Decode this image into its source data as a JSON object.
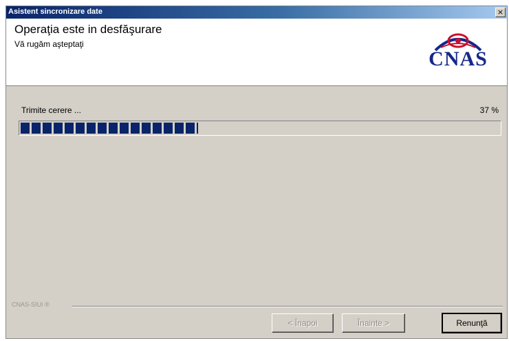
{
  "window": {
    "title": "Asistent sincronizare date",
    "close_glyph": "×"
  },
  "header": {
    "heading": "Operaţia este in desfăşurare",
    "subheading": "Vă rugăm aşteptaţi",
    "logo_text": "CNAS",
    "logo_colors": {
      "eye": "#c8102e",
      "arc": "#16288a"
    }
  },
  "status": {
    "label": "Trimite cerere ...",
    "percent_text": "37 %",
    "progress": 0.37,
    "bar_color": "#0a246a"
  },
  "footer": {
    "brand": "CNAS-SIUI ®"
  },
  "buttons": {
    "back": "< Înapoi",
    "next": "Înainte >",
    "cancel": "Renunţă"
  }
}
